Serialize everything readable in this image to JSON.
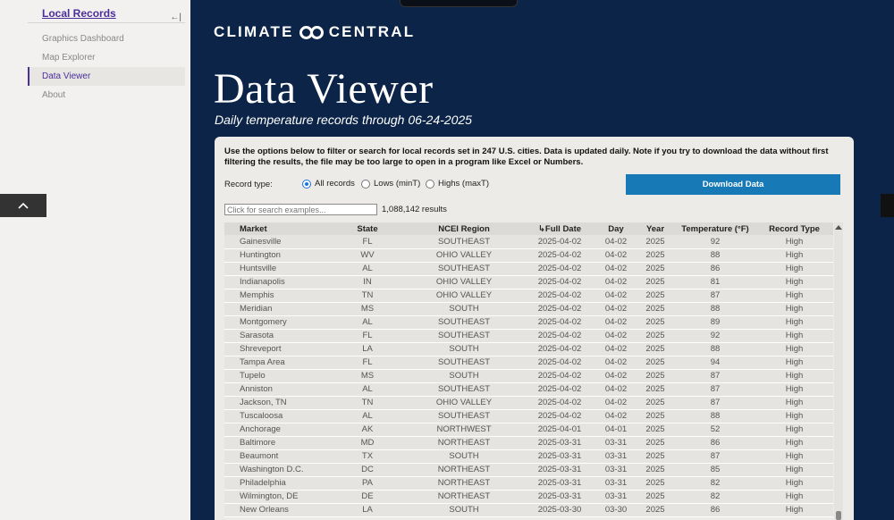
{
  "sidebar": {
    "title": "Local Records",
    "collapse_icon": "collapse-left-icon",
    "items": [
      {
        "label": "Graphics Dashboard",
        "active": false
      },
      {
        "label": "Map Explorer",
        "active": false
      },
      {
        "label": "Data Viewer",
        "active": true
      },
      {
        "label": "About",
        "active": false
      }
    ]
  },
  "header": {
    "logo_left": "CLIMATE",
    "logo_right": "CENTRAL",
    "title": "Data Viewer",
    "subtitle": "Daily temperature records through 06-24-2025"
  },
  "filters": {
    "intro": "Use the options below to filter or search for local records set in 247 U.S. cities. Data is updated daily. Note if you try to download the data without first filtering the results, the file may be too large to open in a program like Excel or Numbers.",
    "record_type_label": "Record type:",
    "options": [
      "All records",
      "Lows (minT)",
      "Highs (maxT)"
    ],
    "selected": "All records",
    "download_label": "Download Data",
    "search_placeholder": "Click for search examples...",
    "results_count": "1,088,142 results"
  },
  "table": {
    "columns": [
      "Market",
      "State",
      "NCEI Region",
      "Full Date",
      "Day",
      "Year",
      "Temperature (°F)",
      "Record Type"
    ],
    "sort_icon": "sort-icon",
    "rows": [
      [
        "Gainesville",
        "FL",
        "SOUTHEAST",
        "2025-04-02",
        "04-02",
        "2025",
        "92",
        "High"
      ],
      [
        "Huntington",
        "WV",
        "OHIO VALLEY",
        "2025-04-02",
        "04-02",
        "2025",
        "88",
        "High"
      ],
      [
        "Huntsville",
        "AL",
        "SOUTHEAST",
        "2025-04-02",
        "04-02",
        "2025",
        "86",
        "High"
      ],
      [
        "Indianapolis",
        "IN",
        "OHIO VALLEY",
        "2025-04-02",
        "04-02",
        "2025",
        "81",
        "High"
      ],
      [
        "Memphis",
        "TN",
        "OHIO VALLEY",
        "2025-04-02",
        "04-02",
        "2025",
        "87",
        "High"
      ],
      [
        "Meridian",
        "MS",
        "SOUTH",
        "2025-04-02",
        "04-02",
        "2025",
        "88",
        "High"
      ],
      [
        "Montgomery",
        "AL",
        "SOUTHEAST",
        "2025-04-02",
        "04-02",
        "2025",
        "89",
        "High"
      ],
      [
        "Sarasota",
        "FL",
        "SOUTHEAST",
        "2025-04-02",
        "04-02",
        "2025",
        "92",
        "High"
      ],
      [
        "Shreveport",
        "LA",
        "SOUTH",
        "2025-04-02",
        "04-02",
        "2025",
        "88",
        "High"
      ],
      [
        "Tampa Area",
        "FL",
        "SOUTHEAST",
        "2025-04-02",
        "04-02",
        "2025",
        "94",
        "High"
      ],
      [
        "Tupelo",
        "MS",
        "SOUTH",
        "2025-04-02",
        "04-02",
        "2025",
        "87",
        "High"
      ],
      [
        "Anniston",
        "AL",
        "SOUTHEAST",
        "2025-04-02",
        "04-02",
        "2025",
        "87",
        "High"
      ],
      [
        "Jackson, TN",
        "TN",
        "OHIO VALLEY",
        "2025-04-02",
        "04-02",
        "2025",
        "87",
        "High"
      ],
      [
        "Tuscaloosa",
        "AL",
        "SOUTHEAST",
        "2025-04-02",
        "04-02",
        "2025",
        "88",
        "High"
      ],
      [
        "Anchorage",
        "AK",
        "NORTHWEST",
        "2025-04-01",
        "04-01",
        "2025",
        "52",
        "High"
      ],
      [
        "Baltimore",
        "MD",
        "NORTHEAST",
        "2025-03-31",
        "03-31",
        "2025",
        "86",
        "High"
      ],
      [
        "Beaumont",
        "TX",
        "SOUTH",
        "2025-03-31",
        "03-31",
        "2025",
        "87",
        "High"
      ],
      [
        "Washington D.C.",
        "DC",
        "NORTHEAST",
        "2025-03-31",
        "03-31",
        "2025",
        "85",
        "High"
      ],
      [
        "Philadelphia",
        "PA",
        "NORTHEAST",
        "2025-03-31",
        "03-31",
        "2025",
        "82",
        "High"
      ],
      [
        "Wilmington, DE",
        "DE",
        "NORTHEAST",
        "2025-03-31",
        "03-31",
        "2025",
        "82",
        "High"
      ],
      [
        "New Orleans",
        "LA",
        "SOUTH",
        "2025-03-30",
        "03-30",
        "2025",
        "86",
        "High"
      ]
    ]
  }
}
